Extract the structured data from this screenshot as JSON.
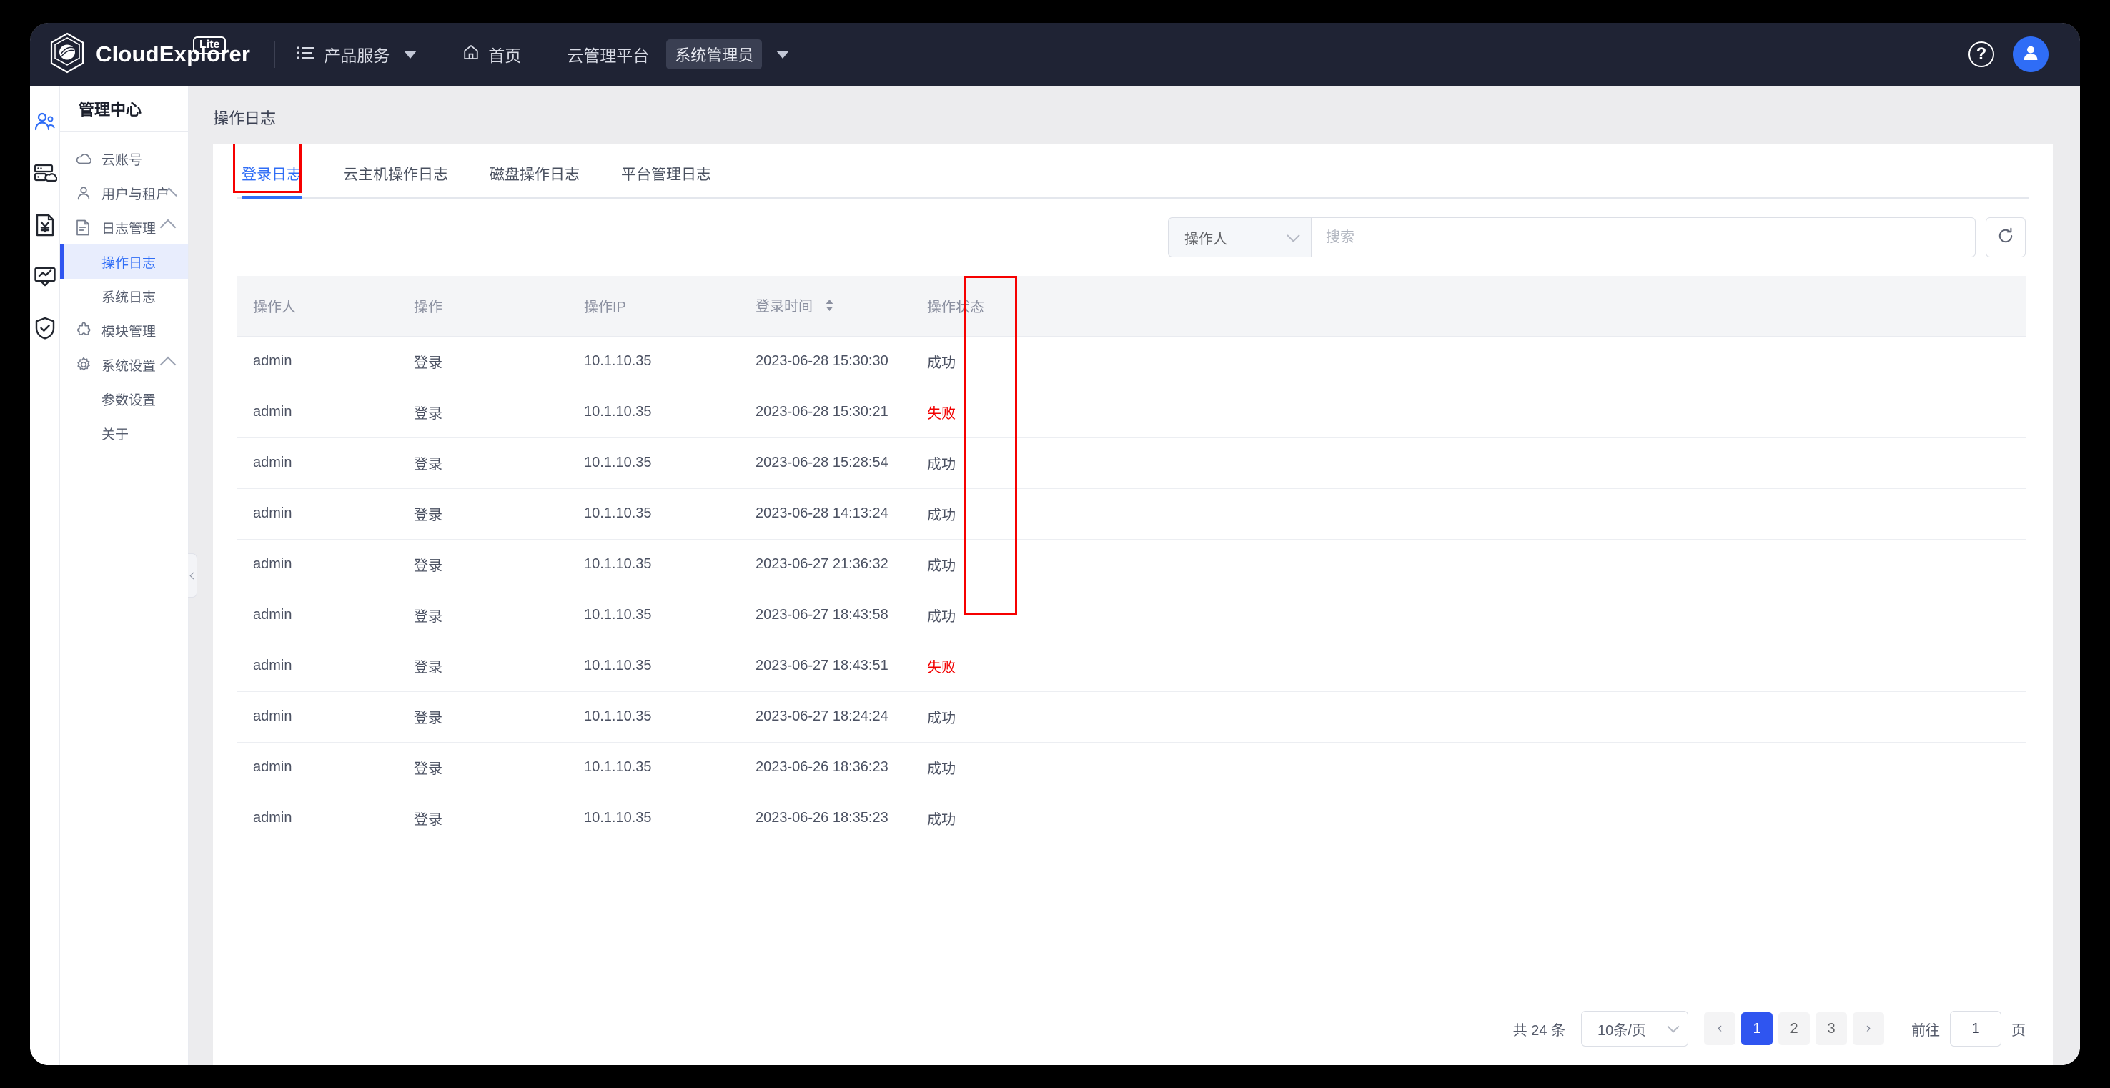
{
  "topbar": {
    "brand_name": "CloudExplorer",
    "brand_badge": "Lite",
    "menu_label": "产品服务",
    "home_label": "首页",
    "platform_label": "云管理平台",
    "role_label": "系统管理员",
    "help_glyph": "?",
    "icons": {
      "menu": "list-menu-icon",
      "home": "home-icon",
      "help": "help-circle-icon",
      "avatar": "user-avatar-icon",
      "caret": "chevron-down-icon"
    }
  },
  "icon_rail": [
    {
      "name": "users-icon",
      "active": true
    },
    {
      "name": "server-cloud-icon",
      "active": false
    },
    {
      "name": "bill-yuan-icon",
      "active": false
    },
    {
      "name": "monitor-chart-icon",
      "active": false
    },
    {
      "name": "shield-check-icon",
      "active": false
    }
  ],
  "sidebar": {
    "title": "管理中心",
    "items": [
      {
        "label": "云账号",
        "icon": "cloud-icon",
        "level": "top",
        "expandable": false
      },
      {
        "label": "用户与租户",
        "icon": "user-icon",
        "level": "top",
        "expandable": true
      },
      {
        "label": "日志管理",
        "icon": "document-icon",
        "level": "top",
        "expandable": true
      },
      {
        "label": "操作日志",
        "icon": "",
        "level": "sub",
        "active": true
      },
      {
        "label": "系统日志",
        "icon": "",
        "level": "sub",
        "active": false
      },
      {
        "label": "模块管理",
        "icon": "puzzle-icon",
        "level": "top",
        "expandable": false
      },
      {
        "label": "系统设置",
        "icon": "gear-icon",
        "level": "top",
        "expandable": true
      },
      {
        "label": "参数设置",
        "icon": "",
        "level": "sub",
        "active": false
      },
      {
        "label": "关于",
        "icon": "",
        "level": "sub",
        "active": false
      }
    ]
  },
  "main": {
    "page_title": "操作日志",
    "tabs": [
      {
        "label": "登录日志",
        "active": true
      },
      {
        "label": "云主机操作日志",
        "active": false
      },
      {
        "label": "磁盘操作日志",
        "active": false
      },
      {
        "label": "平台管理日志",
        "active": false
      }
    ],
    "search": {
      "select_value": "操作人",
      "input_value": "",
      "placeholder": "搜索",
      "refresh_icon": "refresh-icon"
    },
    "table": {
      "columns": [
        {
          "label": "操作人",
          "sortable": false
        },
        {
          "label": "操作",
          "sortable": false
        },
        {
          "label": "操作IP",
          "sortable": false
        },
        {
          "label": "登录时间",
          "sortable": true
        },
        {
          "label": "操作状态",
          "sortable": false
        }
      ],
      "rows": [
        {
          "operator": "admin",
          "operation": "登录",
          "ip": "10.1.10.35",
          "time": "2023-06-28 15:30:30",
          "status": "成功",
          "failed": false
        },
        {
          "operator": "admin",
          "operation": "登录",
          "ip": "10.1.10.35",
          "time": "2023-06-28 15:30:21",
          "status": "失败",
          "failed": true
        },
        {
          "operator": "admin",
          "operation": "登录",
          "ip": "10.1.10.35",
          "time": "2023-06-28 15:28:54",
          "status": "成功",
          "failed": false
        },
        {
          "operator": "admin",
          "operation": "登录",
          "ip": "10.1.10.35",
          "time": "2023-06-28 14:13:24",
          "status": "成功",
          "failed": false
        },
        {
          "operator": "admin",
          "operation": "登录",
          "ip": "10.1.10.35",
          "time": "2023-06-27 21:36:32",
          "status": "成功",
          "failed": false
        },
        {
          "operator": "admin",
          "operation": "登录",
          "ip": "10.1.10.35",
          "time": "2023-06-27 18:43:58",
          "status": "成功",
          "failed": false
        },
        {
          "operator": "admin",
          "operation": "登录",
          "ip": "10.1.10.35",
          "time": "2023-06-27 18:43:51",
          "status": "失败",
          "failed": true
        },
        {
          "operator": "admin",
          "operation": "登录",
          "ip": "10.1.10.35",
          "time": "2023-06-27 18:24:24",
          "status": "成功",
          "failed": false
        },
        {
          "operator": "admin",
          "operation": "登录",
          "ip": "10.1.10.35",
          "time": "2023-06-26 18:36:23",
          "status": "成功",
          "failed": false
        },
        {
          "operator": "admin",
          "operation": "登录",
          "ip": "10.1.10.35",
          "time": "2023-06-26 18:35:23",
          "status": "成功",
          "failed": false
        }
      ]
    },
    "pagination": {
      "total_text": "共 24 条",
      "page_size_label": "10条/页",
      "prev_glyph": "‹",
      "next_glyph": "›",
      "pages": [
        "1",
        "2",
        "3"
      ],
      "current_page": "1",
      "jump_prefix": "前往",
      "jump_value": "1",
      "jump_suffix": "页"
    }
  },
  "colors": {
    "header_bg": "#1f2334",
    "accent_blue": "#2f6df6",
    "active_page_blue": "#2f55f0",
    "fail_red": "#f20000",
    "annotation_red": "#f60000",
    "page_bg": "#ececee"
  }
}
